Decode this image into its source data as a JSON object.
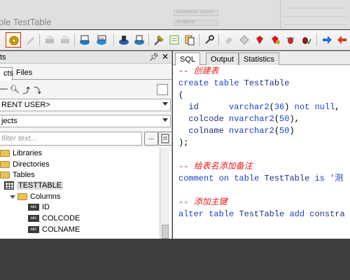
{
  "window": {
    "title_fragment": "ble TestTable",
    "ghost_user_select": "<CURRENT USER>",
    "ghost_objects_select": "All objects"
  },
  "toolbar": {
    "buttons": [
      {
        "name": "gear-settings",
        "color": "#d8a800",
        "selected": true
      },
      {
        "name": "pen-edit",
        "color": "#bcbcbc"
      },
      {
        "name": "print",
        "color": "#b9b9b9"
      },
      {
        "name": "printer2",
        "color": "#c4c4c4"
      },
      {
        "name": "sql-window",
        "color": "#1a7fd0",
        "label": "SQL"
      },
      {
        "name": "command-window",
        "color": "#2a8ad8"
      },
      {
        "name": "compile",
        "color": "#2a5fb0"
      },
      {
        "name": "describe",
        "color": "#2a7ab8"
      },
      {
        "name": "wrench",
        "color": "#c2a020"
      },
      {
        "name": "edit-notes",
        "color": "#5aa030"
      },
      {
        "name": "copy-pages",
        "color": "#d8b040"
      },
      {
        "name": "key",
        "color": "#6a6a6a"
      },
      {
        "name": "erase",
        "color": "#c8c8c8"
      },
      {
        "name": "diamond",
        "color": "#b8b8b8"
      },
      {
        "name": "ruby-red",
        "color": "#c82020"
      },
      {
        "name": "ruby-gold",
        "color": "#d0a030"
      },
      {
        "name": "bug",
        "color": "#c03030"
      },
      {
        "name": "bug-check",
        "color": "#8a1a1a"
      },
      {
        "name": "arrow-right",
        "color": "#2a70d8"
      },
      {
        "name": "arrow-left",
        "color": "#d04020"
      }
    ]
  },
  "left_panel": {
    "header": "ts",
    "tabs": [
      "cts",
      "Files"
    ],
    "user_combo": "RENT USER>",
    "objects_combo": "jects",
    "filter_placeholder": "filter text...",
    "filter_button1": "...",
    "tree": [
      {
        "label": "Libraries",
        "type": "folder",
        "indent": 0
      },
      {
        "label": "Directories",
        "type": "folder",
        "indent": 0
      },
      {
        "label": "Tables",
        "type": "folder",
        "indent": 0
      },
      {
        "label": "TESTTABLE",
        "type": "table",
        "indent": 1,
        "highlight": true
      },
      {
        "label": "Columns",
        "type": "folder-open",
        "indent": 2
      },
      {
        "label": "ID",
        "type": "column",
        "indent": 3
      },
      {
        "label": "COLCODE",
        "type": "column",
        "indent": 3
      },
      {
        "label": "COLNAME",
        "type": "column",
        "indent": 3
      }
    ]
  },
  "right_panel": {
    "tabs": [
      "SQL",
      "Output",
      "Statistics"
    ],
    "active_tab": "SQL",
    "code": [
      {
        "text": "-- 创建表",
        "kind": "comment"
      },
      {
        "text": "create table TestTable",
        "kind": "code"
      },
      {
        "text": "(",
        "kind": "code"
      },
      {
        "text": "  id      varchar2(36) not null,",
        "kind": "code"
      },
      {
        "text": "  colcode nvarchar2(50),",
        "kind": "code"
      },
      {
        "text": "  colname nvarchar2(50)",
        "kind": "code"
      },
      {
        "text": ");",
        "kind": "code"
      },
      {
        "text": "",
        "kind": "blank"
      },
      {
        "text": "-- 给表名添加备注",
        "kind": "comment"
      },
      {
        "text": "comment on table TestTable is '测",
        "kind": "code"
      },
      {
        "text": "",
        "kind": "blank"
      },
      {
        "text": "-- 添加主键",
        "kind": "comment"
      },
      {
        "text": "alter table TestTable add constra",
        "kind": "code"
      }
    ]
  }
}
